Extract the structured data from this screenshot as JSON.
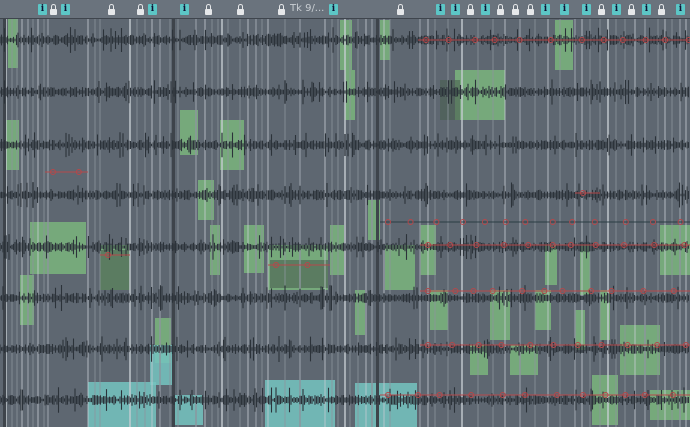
{
  "app": {
    "view": "arrange"
  },
  "header": {
    "track_label": "Tk 9/..."
  },
  "colors": {
    "background": "#5e6771",
    "waveform": "#2c333a",
    "green_item": "#7fbf7f",
    "cyan_item": "#74c4c0",
    "envelope": "#b5484a",
    "info_icon": "#5cc6c6"
  },
  "icons": [
    "lock-icon",
    "info-icon"
  ],
  "lanes": 8,
  "items": [
    {
      "lane": 0,
      "color": "green"
    },
    {
      "lane": 1,
      "color": "green"
    },
    {
      "lane": 2,
      "color": "green"
    },
    {
      "lane": 3,
      "color": "green"
    },
    {
      "lane": 4,
      "color": "green"
    },
    {
      "lane": 5,
      "color": "green"
    },
    {
      "lane": 6,
      "color": "green"
    },
    {
      "lane": 7,
      "color": "cyan"
    }
  ]
}
